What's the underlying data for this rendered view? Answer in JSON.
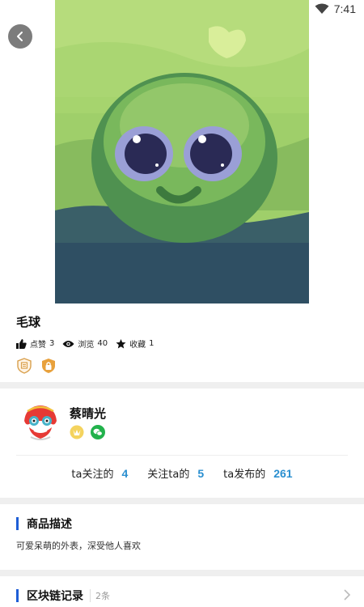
{
  "status": {
    "time": "7:41",
    "icons": [
      "wifi-icon"
    ]
  },
  "product": {
    "title": "毛球",
    "stats": [
      {
        "icon": "thumb-up-icon",
        "label": "点赞",
        "count": "3"
      },
      {
        "icon": "eye-icon",
        "label": "浏览",
        "count": "40"
      },
      {
        "icon": "star-icon",
        "label": "收藏",
        "count": "1"
      }
    ],
    "badges": [
      "certificate-badge-icon",
      "lock-badge-icon"
    ]
  },
  "user": {
    "name": "蔡晴光",
    "icons": [
      "vip-crown-icon",
      "wechat-icon"
    ]
  },
  "follow": {
    "following_label": "ta关注的",
    "following_count": "4",
    "followers_label": "关注ta的",
    "followers_count": "5",
    "published_label": "ta发布的",
    "published_count": "261"
  },
  "description": {
    "title": "商品描述",
    "text": "可爱呆萌的外表，深受他人喜欢"
  },
  "chain": {
    "title": "区块链记录",
    "count": "2条"
  },
  "colors": {
    "accent": "#1e5ed6",
    "number": "#2a8fd0",
    "divider": "#efefef"
  }
}
